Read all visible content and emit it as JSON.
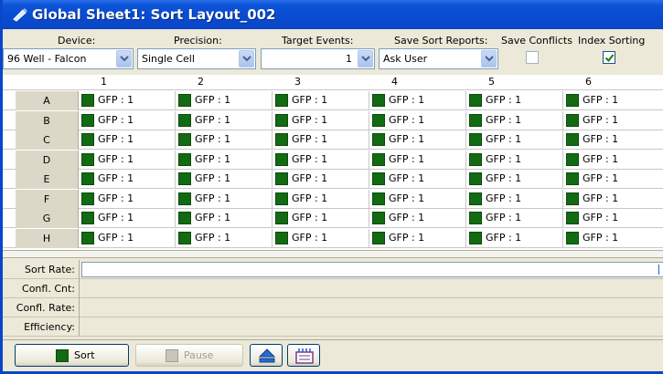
{
  "window": {
    "title": "Global Sheet1: Sort Layout_002"
  },
  "settings": {
    "device": {
      "label": "Device:",
      "value": "96 Well - Falcon"
    },
    "precision": {
      "label": "Precision:",
      "value": "Single Cell"
    },
    "target_events": {
      "label": "Target Events:",
      "value": "1"
    },
    "save_sort_reports": {
      "label": "Save Sort Reports:",
      "value": "Ask User"
    },
    "save_conflicts": {
      "label": "Save Conflicts",
      "checked": false
    },
    "index_sorting": {
      "label": "Index Sorting",
      "checked": true
    }
  },
  "grid": {
    "columns": [
      "1",
      "2",
      "3",
      "4",
      "5",
      "6"
    ],
    "rows": [
      "A",
      "B",
      "C",
      "D",
      "E",
      "F",
      "G",
      "H"
    ],
    "cell_text": "GFP : 1",
    "cell_color": "#126a12"
  },
  "stats": {
    "sort_rate": "Sort Rate:",
    "confl_cnt": "Confl. Cnt:",
    "confl_rate": "Confl. Rate:",
    "efficiency": "Efficiency:"
  },
  "toolbar": {
    "sort_label": "Sort",
    "pause_label": "Pause",
    "eject_icon": "eject-icon",
    "plate_icon": "plate-icon"
  },
  "colors": {
    "title_bar": "#0a46c8",
    "accent": "#126a12"
  }
}
